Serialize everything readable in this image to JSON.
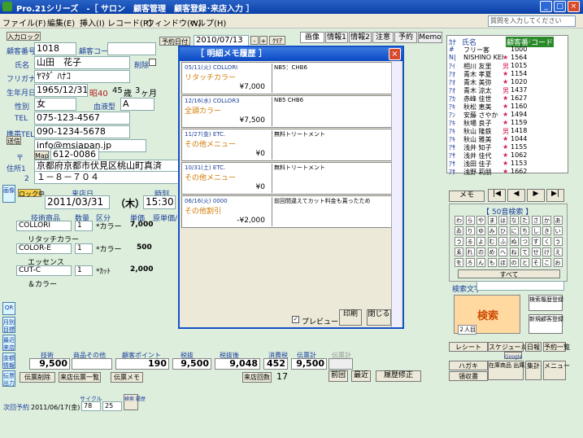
{
  "window": {
    "title": "Pro.21シリーズ　-［ サロン　顧客管理　顧客登録･来店入力 ］",
    "controls": [
      "_",
      "□",
      "×"
    ]
  },
  "menu": {
    "items": [
      "ファイル(F)",
      "編集(E)",
      "挿入(I)",
      "レコード(R)",
      "ウィンドウ(W)",
      "ヘルプ(H)"
    ],
    "help_placeholder": "質問を入力してください"
  },
  "customer": {
    "input_btn": "入力ロック",
    "number_label": "顧客番号",
    "number": "1018",
    "code_label": "顧客コード",
    "name_label": "氏名",
    "name": "山田　花子",
    "kana_label": "フリガナ",
    "kana": "ﾔﾏﾀﾞ ﾊﾅｺ",
    "birth_label": "生年月日",
    "birth": "1965/12/31",
    "era": "昭40",
    "age": "45",
    "age_unit": "歳",
    "months": "3",
    "months_unit": "ヶ月",
    "sex_label": "性別",
    "sex": "女",
    "blood_label": "血液型",
    "blood": "A",
    "tel_label": "TEL",
    "tel": "075-123-4567",
    "mobile_label": "携帯TEL",
    "mobile": "090-1234-5678",
    "mail_btn": "送信",
    "mail": "info@msjapan.jp",
    "zip_label": "〒",
    "map_btn": "Map",
    "zip": "612-0086",
    "addr1_label": "住所1",
    "addr1": "京都府京都市伏見区桃山町真済",
    "addr2_label": "2",
    "addr2": "１－８－７０４",
    "dm_label": "削除"
  },
  "reserve": {
    "label": "予約日付",
    "date": "2010/07/13",
    "clear": "ｸﾘｱ"
  },
  "tabs": [
    "画像",
    "情報1",
    "情報2",
    "注意",
    "予約",
    "Memo"
  ],
  "visit": {
    "lock": "ロック中",
    "date_label": "来店日",
    "date": "2011/03/31",
    "dow": "（木）",
    "time_label": "時刻",
    "time": "15:30",
    "cols": [
      "技術商品",
      "数量",
      "区分",
      "単価",
      "原単価/"
    ],
    "rows": [
      {
        "code": "COLLORI",
        "qty": "1",
        "cat": "*カラー",
        "price": "7,000",
        "name": "リタッチカラー"
      },
      {
        "code": "COLOR-E",
        "qty": "1",
        "cat": "*カラー",
        "price": "500",
        "name": "エッセンス"
      },
      {
        "code": "CUT-C",
        "qty": "1",
        "cat": "*ｶｯﾄ",
        "price": "2,000",
        "name": "＆カラー"
      }
    ]
  },
  "popup": {
    "title": "［ 明細メモ履歴 ］",
    "entries": [
      {
        "date": "05/11(火)  COLLORI",
        "name": "リタッチカラー",
        "price": "¥7,000",
        "note": "NB5：CHB6"
      },
      {
        "date": "12/16(水)  COLLOR3",
        "name": "全頭カラー",
        "price": "¥7,500",
        "note": "NB5 CHB6"
      },
      {
        "date": "11/27(金)  ETC.",
        "name": "その他メニュー",
        "price": "¥0",
        "note": "無料トリートメント"
      },
      {
        "date": "10/31(土)  ETC.",
        "name": "その他メニュー",
        "price": "¥0",
        "note": "無料トリートメント"
      },
      {
        "date": "06/16(火)  0000",
        "name": "その他割引",
        "price": "-¥2,000",
        "note": "前回間違えてカット料金も貰ったため"
      }
    ],
    "preview": "プレビュー",
    "print": "印刷",
    "close": "閉じる"
  },
  "list": {
    "cols": [
      "ｶﾅ",
      "氏名",
      "顧客番号",
      "コード"
    ],
    "rows": [
      {
        "k": "#",
        "n": "フリー客",
        "s": "",
        "c": "1000"
      },
      {
        "k": "N|",
        "n": "NISHINO KEI",
        "s": "★",
        "c": "1564"
      },
      {
        "k": "ｱｲ",
        "n": "相川 友里",
        "s": "男",
        "c": "1015"
      },
      {
        "k": "ｱｵ",
        "n": "青木 孝夏",
        "s": "★",
        "c": "1154"
      },
      {
        "k": "ｱｵ",
        "n": "青木 美弥",
        "s": "★",
        "c": "1020"
      },
      {
        "k": "ｱｵ",
        "n": "青木 涼太",
        "s": "男",
        "c": "1437"
      },
      {
        "k": "ｱｶ",
        "n": "赤峰 佳世",
        "s": "★",
        "c": "1627"
      },
      {
        "k": "ｱｷ",
        "n": "秋松 恵美",
        "s": "★",
        "c": "1160"
      },
      {
        "k": "ｱﾝ",
        "n": "安藤 さやか",
        "s": "★",
        "c": "1494"
      },
      {
        "k": "ｱｷ",
        "n": "秋場 良子",
        "s": "★",
        "c": "1159"
      },
      {
        "k": "ｱｷ",
        "n": "秋山 隆鉄",
        "s": "男",
        "c": "1418"
      },
      {
        "k": "ｱｷ",
        "n": "秋山 雅美",
        "s": "★",
        "c": "1044"
      },
      {
        "k": "ｱｻ",
        "n": "浅井 知子",
        "s": "★",
        "c": "1155"
      },
      {
        "k": "ｱｻ",
        "n": "浅井 佳代",
        "s": "★",
        "c": "1062"
      },
      {
        "k": "ｱｻ",
        "n": "浅田 佳子",
        "s": "★",
        "c": "1153"
      },
      {
        "k": "ｱｻ",
        "n": "浅野 莉朋",
        "s": "★",
        "c": "1662"
      }
    ]
  },
  "nav": {
    "memo": "メモ",
    "arrows": [
      "|◀",
      "◀",
      "▶",
      "▶|"
    ],
    "kana_title": "【 50音検索 】",
    "kana_all": "すべて",
    "search_label": "検索文字",
    "search_btn": "検索",
    "search_sub": "２人目",
    "history_btn": "検索履歴登録",
    "new_btn": "新規顧客登録"
  },
  "kana_chars": [
    "わ",
    "ら",
    "や",
    "ま",
    "は",
    "な",
    "た",
    "さ",
    "か",
    "あ",
    "ゐ",
    "り",
    "ゆ",
    "み",
    "ひ",
    "に",
    "ち",
    "し",
    "き",
    "い",
    "う",
    "る",
    "よ",
    "む",
    "ふ",
    "ぬ",
    "つ",
    "す",
    "く",
    "う",
    "ゑ",
    "れ",
    "の",
    "め",
    "へ",
    "ね",
    "て",
    "せ",
    "け",
    "え",
    "を",
    "ろ",
    "ん",
    "も",
    "ほ",
    "の",
    "と",
    "そ",
    "こ",
    "お"
  ],
  "totals": [
    {
      "label": "技術",
      "value": "9,500"
    },
    {
      "label": "商品その他",
      "value": ""
    },
    {
      "label": "顧客ポイント",
      "value": "190"
    },
    {
      "label": "税抜",
      "value": "9,500"
    },
    {
      "label": "税抜後",
      "value": "9,048"
    },
    {
      "label": "消費税",
      "value": "452"
    },
    {
      "label": "伝票計",
      "value": "9,500"
    },
    {
      "label": "伝票計",
      "value": ""
    }
  ],
  "bottom": {
    "slip_del": "伝票削除",
    "history_list": "来店伝票一覧",
    "slip_memo": "伝票メモ",
    "visits_label": "来店回数",
    "visits": "17",
    "prev": "前回",
    "latest": "最近",
    "fix": "履歴修正",
    "next_label": "次回予約",
    "next_date": "2011/06/17(金)",
    "cycle_label": "サイクル",
    "cycle1": "78",
    "cycle2": "25",
    "search_btn": "検索 履歴"
  },
  "right_bottom": {
    "btns": [
      "レシート",
      "スケジュール",
      "日報",
      "予約一覧",
      "ハガキ",
      "在庫商品 出庫履歴",
      "集計",
      "メニュー",
      "領収書"
    ],
    "google": "Google"
  },
  "side_buttons": [
    "画像",
    "QR",
    "月別 目標",
    "最近 来店",
    "金額 情報",
    "伝票 出力"
  ]
}
